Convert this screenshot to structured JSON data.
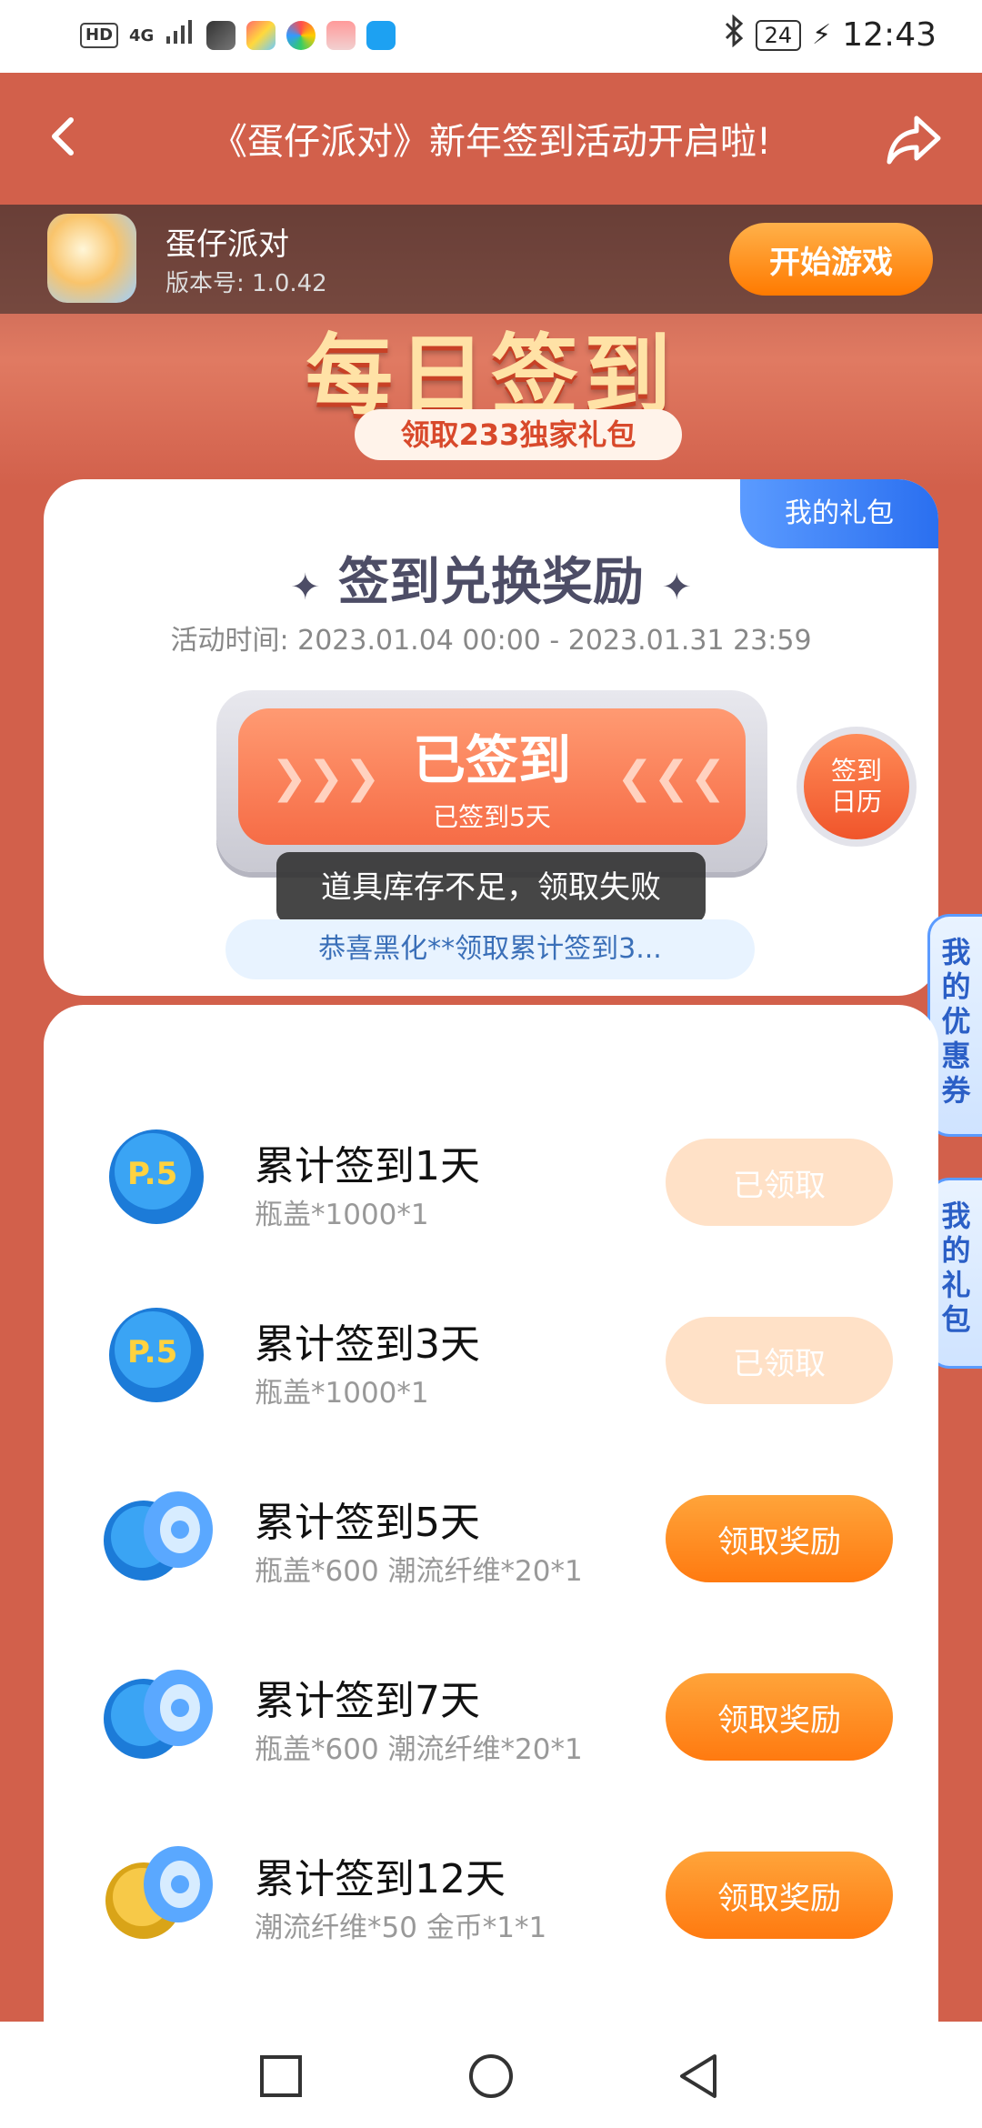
{
  "status_bar": {
    "hd": "HD",
    "network": "4G",
    "time": "12:43",
    "battery": "24"
  },
  "header": {
    "title": "《蛋仔派对》新年签到活动开启啦!"
  },
  "game": {
    "name": "蛋仔派对",
    "version": "版本号: 1.0.42",
    "start_label": "开始游戏"
  },
  "banner": {
    "title": "每日签到",
    "subtitle": "领取233独家礼包"
  },
  "card": {
    "title": "签到兑换奖励",
    "my_gift_tab": "我的礼包",
    "time": "活动时间:  2023.01.04 00:00 - 2023.01.31 23:59",
    "signed_label": "已签到",
    "signed_sub": "已签到5天",
    "calendar_label": "签到\n日历",
    "toast": "道具库存不足，领取失败",
    "marquee": "恭喜黑化**领取累计签到3..."
  },
  "side_tabs": {
    "coupons": "我的优惠券",
    "gifts": "我的礼包"
  },
  "rewards": [
    {
      "title": "累计签到1天",
      "detail": "瓶盖*1000*1",
      "button": "已领取",
      "state": "claimed",
      "icon": "bottle-cap-icon"
    },
    {
      "title": "累计签到3天",
      "detail": "瓶盖*1000*1",
      "button": "已领取",
      "state": "claimed",
      "icon": "bottle-cap-icon"
    },
    {
      "title": "累计签到5天",
      "detail": "瓶盖*600 潮流纤维*20*1",
      "button": "领取奖励",
      "state": "available",
      "icon": "cap-and-fiber-icon"
    },
    {
      "title": "累计签到7天",
      "detail": "瓶盖*600 潮流纤维*20*1",
      "button": "领取奖励",
      "state": "available",
      "icon": "cap-and-fiber-icon"
    },
    {
      "title": "累计签到12天",
      "detail": "潮流纤维*50 金币*1*1",
      "button": "领取奖励",
      "state": "available",
      "icon": "coin-and-fiber-icon"
    }
  ],
  "colors": {
    "page_bg": "#d2604b",
    "accent_orange": "#ff7a10",
    "blue": "#2a6ff0"
  }
}
